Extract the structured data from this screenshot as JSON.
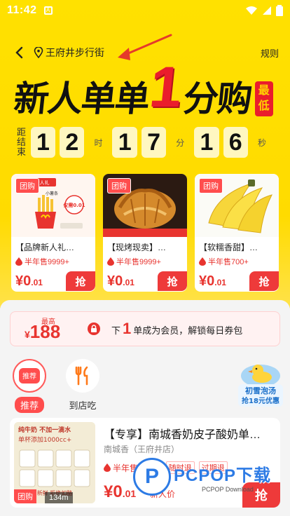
{
  "status_bar": {
    "time": "11:42"
  },
  "nav": {
    "location": "王府井步行街",
    "rules": "规则"
  },
  "headline": {
    "part1": "新人单单",
    "part2": "1",
    "part3": "分购",
    "badge": "最低"
  },
  "countdown": {
    "label": "距结束",
    "hours": [
      "1",
      "2"
    ],
    "hours_unit": "时",
    "minutes": [
      "1",
      "7"
    ],
    "minutes_unit": "分",
    "seconds": [
      "1",
      "6"
    ],
    "seconds_unit": "秒"
  },
  "featured": [
    {
      "tag": "团购",
      "name": "【品牌新人礼…",
      "sold": "半年售9999+",
      "price_int": "¥0",
      "price_dec": ".01",
      "button": "抢",
      "image": "mcdonalds-fries",
      "image_text_top": "超值新人礼",
      "image_text_sub": "小薯条",
      "image_badge": "仅需0.01"
    },
    {
      "tag": "团购",
      "name": "【现烤现卖】…",
      "sold": "半年售9999+",
      "price_int": "¥0",
      "price_dec": ".01",
      "button": "抢",
      "image": "croissant"
    },
    {
      "tag": "团购",
      "name": "【软糯香甜】…",
      "sold": "半年售700+",
      "price_int": "¥0",
      "price_dec": ".01",
      "button": "抢",
      "image": "bananas"
    }
  ],
  "member_banner": {
    "coupon_label": "最高",
    "coupon_currency": "¥",
    "coupon_amount": "188",
    "text_before": "下",
    "count": "1",
    "text_after": "单成为会员，解锁每日券包"
  },
  "categories": [
    {
      "label": "推荐",
      "active": true,
      "icon_text": "推荐"
    },
    {
      "label": "到店吃",
      "active": false
    }
  ],
  "promo": {
    "line1": "初雪泡汤",
    "line2": "抢18元优惠"
  },
  "card": {
    "title": "【专享】南城香奶皮子酸奶单…",
    "shop": "南城香（王府井店）",
    "sold": "半年售9999+",
    "chip1": "随时退",
    "chip2": "过期退",
    "price_int": "¥0",
    "price_dec": ".01",
    "newcomer": "新人价",
    "button": "抢",
    "tag": "团购",
    "distance": "134m",
    "image_text_top": "纯牛奶 不加一滴水",
    "image_text_mid": "单杯添加1000cc+",
    "image_text_bottom": "新鲜 拒绝如酪"
  },
  "watermark": {
    "main": "PCPOP下载",
    "sub": "PCPOP Download"
  },
  "colors": {
    "hero": "#ffdb00",
    "accent_red": "#ea1d2c",
    "price_red": "#e8342f"
  }
}
